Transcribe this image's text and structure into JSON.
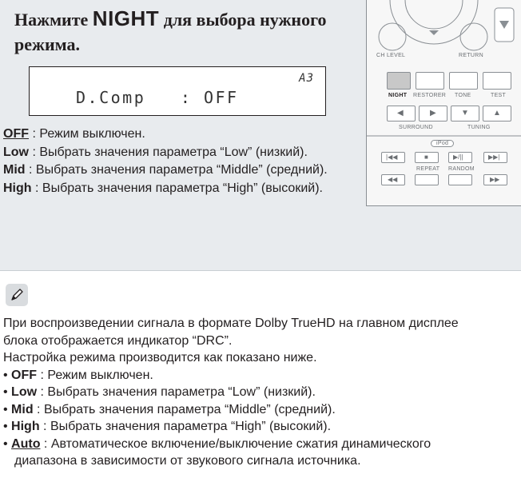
{
  "heading": {
    "pre": "Нажмите ",
    "key": "NIGHT",
    "post": " для выбора нужного режима."
  },
  "lcd": {
    "indicator": "A3",
    "text": "D.Comp   : OFF"
  },
  "options": [
    {
      "key": "OFF",
      "sep": " : ",
      "text": "Режим выключен."
    },
    {
      "key": "Low",
      "sep": " : ",
      "text": "Выбрать значения параметра “Low” (низкий)."
    },
    {
      "key": "Mid",
      "sep": " : ",
      "text": "Выбрать значения параметра “Middle” (средний)."
    },
    {
      "key": "High",
      "sep": " : ",
      "text": "Выбрать значения параметра “High” (высокий)."
    }
  ],
  "remote": {
    "ch_level": "CH LEVEL",
    "return": "RETURN",
    "night": "NIGHT",
    "restorer": "RESTORER",
    "tone": "TONE",
    "test": "TEST",
    "surround": "SURROUND",
    "tuning": "TUNING",
    "ipod": "iPod",
    "repeat": "REPEAT",
    "random": "RANDOM"
  },
  "note": {
    "icon": "pencil-icon",
    "line1": "При воспроизведении сигнала в формате Dolby TrueHD на главном дисплее",
    "line2": "блока отображается индикатор “DRC”.",
    "line3": "Настройка режима производится как показано ниже.",
    "items": [
      {
        "key": "OFF",
        "sep": " : ",
        "text": "Режим выключен."
      },
      {
        "key": "Low",
        "sep": " : ",
        "text": "Выбрать значения параметра “Low” (низкий)."
      },
      {
        "key": "Mid",
        "sep": " : ",
        "text": "Выбрать значения параметра “Middle” (средний)."
      },
      {
        "key": "High",
        "sep": " : ",
        "text": "Выбрать значения параметра “High” (высокий)."
      },
      {
        "key": "Auto",
        "sep": " : ",
        "text": "Автоматическое включение/выключение сжатия динамического"
      }
    ],
    "continuation": "диапазона в зависимости от звукового сигнала источника."
  }
}
